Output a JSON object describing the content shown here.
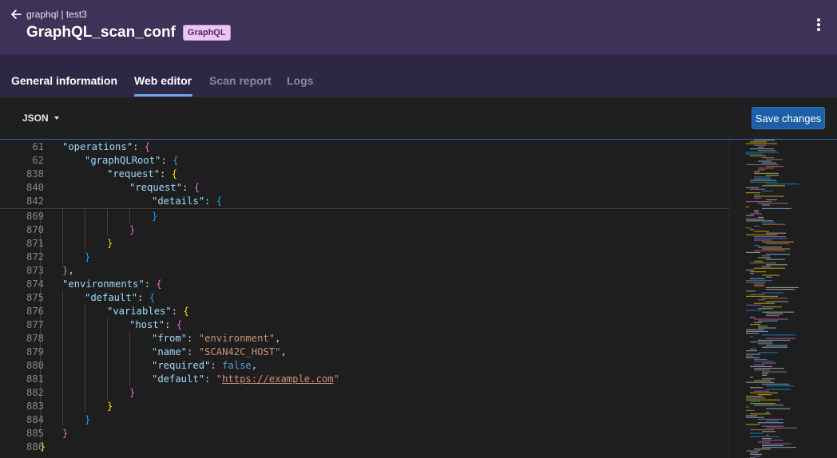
{
  "header": {
    "breadcrumb": "graphql | test3",
    "title": "GraphQL_scan_conf",
    "badge": "GraphQL",
    "back_icon": "arrow-left-icon",
    "menu_icon": "more-vertical-icon"
  },
  "tabs": [
    {
      "label": "General information",
      "active": false
    },
    {
      "label": "Web editor",
      "active": true
    },
    {
      "label": "Scan report",
      "active": false
    },
    {
      "label": "Logs",
      "active": false
    }
  ],
  "toolbar": {
    "format": "JSON",
    "save_label": "Save changes"
  },
  "editor": {
    "sticky_lines": [
      {
        "num": "61",
        "indent": 1,
        "tokens": [
          [
            "k",
            "\"operations\""
          ],
          [
            "ws",
            ": "
          ],
          [
            "b2",
            "{"
          ]
        ]
      },
      {
        "num": "62",
        "indent": 2,
        "tokens": [
          [
            "k",
            "\"graphQLRoot\""
          ],
          [
            "ws",
            ": "
          ],
          [
            "b3",
            "{"
          ]
        ]
      },
      {
        "num": "838",
        "indent": 3,
        "tokens": [
          [
            "k",
            "\"request\""
          ],
          [
            "ws",
            ": "
          ],
          [
            "b1",
            "{"
          ]
        ]
      },
      {
        "num": "840",
        "indent": 4,
        "tokens": [
          [
            "k",
            "\"request\""
          ],
          [
            "ws",
            ": "
          ],
          [
            "b2",
            "{"
          ]
        ]
      },
      {
        "num": "842",
        "indent": 5,
        "tokens": [
          [
            "k",
            "\"details\""
          ],
          [
            "ws",
            ": "
          ],
          [
            "b3",
            "{"
          ]
        ]
      }
    ],
    "lines": [
      {
        "num": "869",
        "indent": 5,
        "tokens": [
          [
            "b3",
            "}"
          ]
        ]
      },
      {
        "num": "870",
        "indent": 4,
        "tokens": [
          [
            "b2",
            "}"
          ]
        ]
      },
      {
        "num": "871",
        "indent": 3,
        "tokens": [
          [
            "b1",
            "}"
          ]
        ]
      },
      {
        "num": "872",
        "indent": 2,
        "tokens": [
          [
            "b3",
            "}"
          ]
        ]
      },
      {
        "num": "873",
        "indent": 1,
        "tokens": [
          [
            "b2",
            "}"
          ],
          [
            "ws",
            ","
          ]
        ]
      },
      {
        "num": "874",
        "indent": 1,
        "tokens": [
          [
            "k",
            "\"environments\""
          ],
          [
            "ws",
            ": "
          ],
          [
            "b2",
            "{"
          ]
        ]
      },
      {
        "num": "875",
        "indent": 2,
        "tokens": [
          [
            "k",
            "\"default\""
          ],
          [
            "ws",
            ": "
          ],
          [
            "b3",
            "{"
          ]
        ]
      },
      {
        "num": "876",
        "indent": 3,
        "tokens": [
          [
            "k",
            "\"variables\""
          ],
          [
            "ws",
            ": "
          ],
          [
            "b1",
            "{"
          ]
        ]
      },
      {
        "num": "877",
        "indent": 4,
        "tokens": [
          [
            "k",
            "\"host\""
          ],
          [
            "ws",
            ": "
          ],
          [
            "b2",
            "{"
          ]
        ]
      },
      {
        "num": "878",
        "indent": 5,
        "tokens": [
          [
            "k",
            "\"from\""
          ],
          [
            "ws",
            ": "
          ],
          [
            "s",
            "\"environment\""
          ],
          [
            "ws",
            ","
          ]
        ]
      },
      {
        "num": "879",
        "indent": 5,
        "tokens": [
          [
            "k",
            "\"name\""
          ],
          [
            "ws",
            ": "
          ],
          [
            "s",
            "\"SCAN42C_HOST\""
          ],
          [
            "ws",
            ","
          ]
        ]
      },
      {
        "num": "880",
        "indent": 5,
        "tokens": [
          [
            "k",
            "\"required\""
          ],
          [
            "ws",
            ": "
          ],
          [
            "kw",
            "false"
          ],
          [
            "ws",
            ","
          ]
        ]
      },
      {
        "num": "881",
        "indent": 5,
        "tokens": [
          [
            "k",
            "\"default\""
          ],
          [
            "ws",
            ": "
          ],
          [
            "s",
            "\""
          ],
          [
            "su",
            "https://example.com"
          ],
          [
            "s",
            "\""
          ]
        ]
      },
      {
        "num": "882",
        "indent": 4,
        "tokens": [
          [
            "b2",
            "}"
          ]
        ]
      },
      {
        "num": "883",
        "indent": 3,
        "tokens": [
          [
            "b1",
            "}"
          ]
        ]
      },
      {
        "num": "884",
        "indent": 2,
        "tokens": [
          [
            "b3",
            "}"
          ]
        ]
      },
      {
        "num": "885",
        "indent": 1,
        "tokens": [
          [
            "b2",
            "}"
          ]
        ]
      },
      {
        "num": "886",
        "indent": 0,
        "tokens": [
          [
            "b1",
            "}"
          ]
        ]
      }
    ]
  },
  "colors": {
    "header_bg": "#3d3358",
    "tabs_bg": "#2e2744",
    "accent": "#6fa8e6",
    "save_button": "#1f5fa8",
    "badge_bg": "#e7c8ef"
  }
}
